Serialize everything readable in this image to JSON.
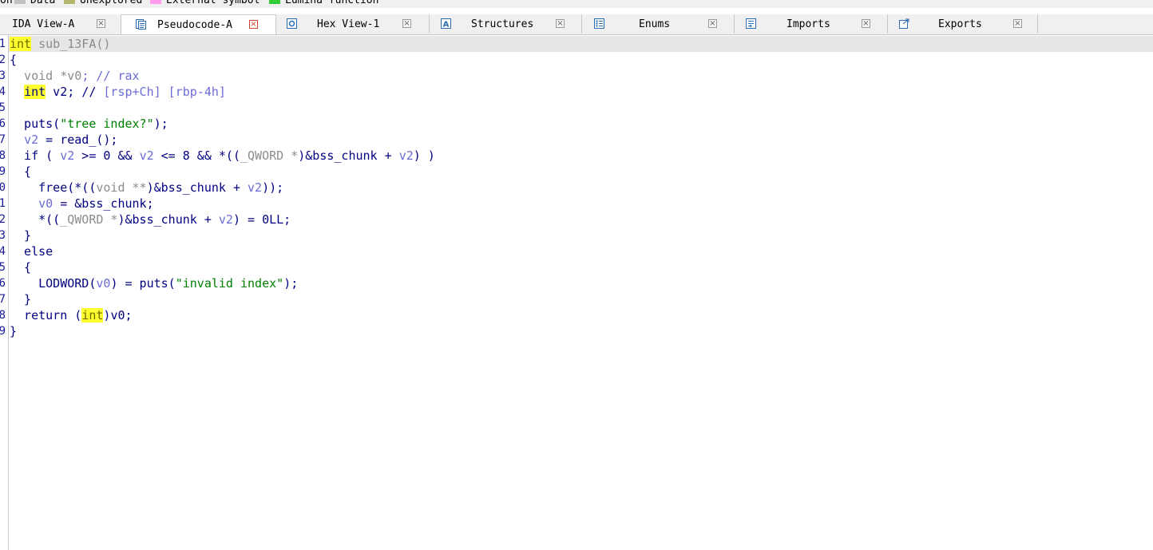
{
  "legend": [
    {
      "label": "on",
      "color": null
    },
    {
      "label": "Data",
      "color": "#c0c0c0"
    },
    {
      "label": "Unexplored",
      "color": "#b5b66e"
    },
    {
      "label": "External symbol",
      "color": "#ff9cf0"
    },
    {
      "label": "Lumina function",
      "color": "#33cc33"
    }
  ],
  "tabs": [
    {
      "label": "IDA View-A",
      "icon": "ida-view-icon"
    },
    {
      "label": "Pseudocode-A",
      "icon": "pseudocode-icon",
      "active": true
    },
    {
      "label": "Hex View-1",
      "icon": "hex-view-icon"
    },
    {
      "label": "Structures",
      "icon": "structures-icon"
    },
    {
      "label": "Enums",
      "icon": "enums-icon"
    },
    {
      "label": "Imports",
      "icon": "imports-icon"
    },
    {
      "label": "Exports",
      "icon": "exports-icon"
    }
  ],
  "line_numbers": [
    "1",
    "2",
    "3",
    "4",
    "5",
    "6",
    "7",
    "8",
    "9",
    "0",
    "1",
    "2",
    "3",
    "4",
    "5",
    "6",
    "7",
    "8",
    "9"
  ],
  "code": {
    "l1": {
      "t": "int",
      "rest": " sub_13FA()"
    },
    "l2": "{",
    "l3": {
      "a": "  void *",
      "b": "v0",
      "c": "; // rax"
    },
    "l4": {
      "t": "int",
      "a": " v2; // ",
      "b": "[rsp+Ch] [rbp-4h]"
    },
    "l6": {
      "a": "  puts(",
      "s": "\"tree index?\"",
      "c": ");"
    },
    "l7": {
      "v": "v2",
      "a": " = read_();"
    },
    "l8": {
      "a": "  if ( ",
      "v1": "v2",
      "b": " >= 0 && ",
      "v2": "v2",
      "c": " <= 8 && *((",
      "g": "_QWORD *",
      "d": ")&bss_chunk + ",
      "v3": "v2",
      "e": ") )"
    },
    "l9": "  {",
    "l10": {
      "a": "    free(*((",
      "g": "void **",
      "b": ")&bss_chunk + ",
      "v": "v2",
      "c": "));"
    },
    "l11": {
      "v": "v0",
      "a": " = &bss_chunk;"
    },
    "l12": {
      "a": "    *((",
      "g": "_QWORD *",
      "b": ")&bss_chunk + ",
      "v": "v2",
      "c": ") = 0LL;"
    },
    "l13": "  }",
    "l14": "  else",
    "l15": "  {",
    "l16": {
      "a": "    LODWORD(",
      "v": "v0",
      "b": ") = puts(",
      "s": "\"invalid index\"",
      "c": ");"
    },
    "l17": "  }",
    "l18": {
      "a": "  return (",
      "t": "int",
      "b": ")",
      "v": "v0",
      "c": ";"
    },
    "l19": "}"
  }
}
